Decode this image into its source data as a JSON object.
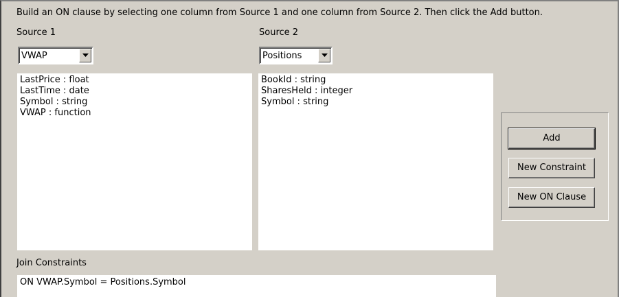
{
  "instructions": "Build an ON clause by selecting one column from Source 1 and one column from Source 2. Then click the Add button.",
  "source1": {
    "label": "Source 1",
    "selected": "VWAP",
    "columns": [
      "LastPrice : float",
      "LastTime : date",
      "Symbol : string",
      "VWAP : function"
    ]
  },
  "source2": {
    "label": "Source 2",
    "selected": "Positions",
    "columns": [
      "BookId : string",
      "SharesHeld : integer",
      "Symbol : string"
    ]
  },
  "buttons": {
    "add": "Add",
    "new_constraint": "New Constraint",
    "new_on_clause": "New ON Clause"
  },
  "join_constraints": {
    "label": "Join Constraints",
    "value": "ON VWAP.Symbol = Positions.Symbol"
  }
}
